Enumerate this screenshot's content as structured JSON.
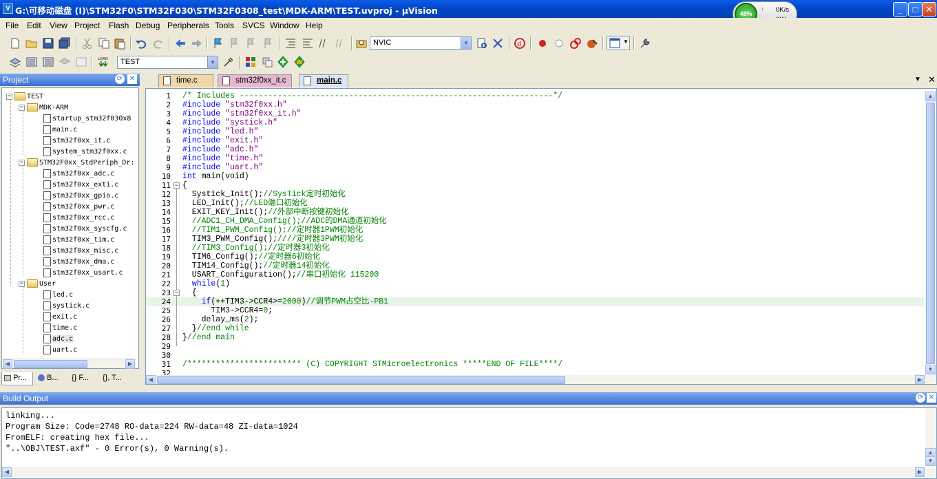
{
  "window": {
    "title": "G:\\可移动磁盘 (I)\\STM32F0\\STM32F030\\STM32F0308_test\\MDK-ARM\\TEST.uvproj - µVision",
    "app_icon": "V",
    "buttons": {
      "minimize": "_",
      "maximize": "□",
      "close": "✕"
    }
  },
  "net_widget": {
    "percent": "48%",
    "up_rate": "0K/s",
    "down_rate": "0K/s",
    "up_arrow": "↑",
    "down_arrow": "↓"
  },
  "menu": [
    "File",
    "Edit",
    "View",
    "Project",
    "Flash",
    "Debug",
    "Peripherals",
    "Tools",
    "SVCS",
    "Window",
    "Help"
  ],
  "toolbar": {
    "find_combo": "NVIC",
    "target_combo": "TEST"
  },
  "project_panel": {
    "title": "Project",
    "tree": [
      {
        "label": "TEST",
        "level": 0,
        "kind": "target",
        "expander": "−"
      },
      {
        "label": "MDK-ARM",
        "level": 1,
        "kind": "folder",
        "expander": "−"
      },
      {
        "label": "startup_stm32f030x8",
        "level": 2,
        "kind": "file"
      },
      {
        "label": "main.c",
        "level": 2,
        "kind": "file"
      },
      {
        "label": "stm32f0xx_it.c",
        "level": 2,
        "kind": "file"
      },
      {
        "label": "system_stm32f0xx.c",
        "level": 2,
        "kind": "file"
      },
      {
        "label": "STM32F0xx_StdPeriph_Dr:",
        "level": 1,
        "kind": "folder",
        "expander": "−"
      },
      {
        "label": "stm32f0xx_adc.c",
        "level": 2,
        "kind": "file"
      },
      {
        "label": "stm32f0xx_exti.c",
        "level": 2,
        "kind": "file"
      },
      {
        "label": "stm32f0xx_gpio.c",
        "level": 2,
        "kind": "file"
      },
      {
        "label": "stm32f0xx_pwr.c",
        "level": 2,
        "kind": "file"
      },
      {
        "label": "stm32f0xx_rcc.c",
        "level": 2,
        "kind": "file"
      },
      {
        "label": "stm32f0xx_syscfg.c",
        "level": 2,
        "kind": "file"
      },
      {
        "label": "stm32f0xx_tim.c",
        "level": 2,
        "kind": "file"
      },
      {
        "label": "stm32f0xx_misc.c",
        "level": 2,
        "kind": "file"
      },
      {
        "label": "stm32f0xx_dma.c",
        "level": 2,
        "kind": "file"
      },
      {
        "label": "stm32f0xx_usart.c",
        "level": 2,
        "kind": "file"
      },
      {
        "label": "User",
        "level": 1,
        "kind": "folder",
        "expander": "−"
      },
      {
        "label": "led.c",
        "level": 2,
        "kind": "file"
      },
      {
        "label": "systick.c",
        "level": 2,
        "kind": "file"
      },
      {
        "label": "exit.c",
        "level": 2,
        "kind": "file"
      },
      {
        "label": "time.c",
        "level": 2,
        "kind": "file"
      },
      {
        "label": "adc.c",
        "level": 2,
        "kind": "file",
        "selected": true
      },
      {
        "label": "uart.c",
        "level": 2,
        "kind": "file"
      }
    ],
    "tabs": [
      "Pr...",
      "B...",
      "{} F...",
      "{}, T..."
    ]
  },
  "editor_tabs": [
    {
      "label": "time.c",
      "active": false,
      "color": "#f0d8a8"
    },
    {
      "label": "stm32f0xx_it.c",
      "active": false,
      "color": "#e8b8d0"
    },
    {
      "label": "main.c",
      "active": true,
      "color": "#d8e6f8"
    }
  ],
  "editor": {
    "current_line": 24,
    "lines": [
      {
        "n": "1",
        "text": "/* Includes ------------------------------------------------------------------*/",
        "cls": "cm"
      },
      {
        "n": "2",
        "text": "#include \"stm32f0xx.h\"",
        "cls": "pp"
      },
      {
        "n": "3",
        "text": "#include \"stm32f0xx_it.h\"",
        "cls": "pp"
      },
      {
        "n": "4",
        "text": "#include \"systick.h\"",
        "cls": "pp"
      },
      {
        "n": "5",
        "text": "#include \"led.h\"",
        "cls": "pp"
      },
      {
        "n": "6",
        "text": "#include \"exit.h\"",
        "cls": "pp"
      },
      {
        "n": "7",
        "text": "#include \"adc.h\"",
        "cls": "pp"
      },
      {
        "n": "8",
        "text": "#include \"time.h\"",
        "cls": "pp"
      },
      {
        "n": "9",
        "text": "#include \"uart.h\"",
        "cls": "pp"
      },
      {
        "n": "10",
        "text": "int main(void)",
        "cls": "int"
      },
      {
        "n": "11",
        "text": "{",
        "cls": "plain"
      },
      {
        "n": "12",
        "text": "  Systick_Init();//SysTick定时初始化",
        "cls": "call"
      },
      {
        "n": "13",
        "text": "  LED_Init();//LED端口初始化",
        "cls": "call"
      },
      {
        "n": "14",
        "text": "  EXIT_KEY_Init();//外部中断按键初始化",
        "cls": "call"
      },
      {
        "n": "15",
        "text": "  //ADC1_CH_DMA_Config();//ADC的DMA通道初始化",
        "cls": "cm"
      },
      {
        "n": "16",
        "text": "  //TIM1_PWM_Config();//定时器1PWM初始化",
        "cls": "cm"
      },
      {
        "n": "17",
        "text": "  TIM3_PWM_Config();////定时器3PWM初始化",
        "cls": "call"
      },
      {
        "n": "18",
        "text": "  //TIM3_Config();//定时器3初始化",
        "cls": "cm"
      },
      {
        "n": "19",
        "text": "  TIM6_Config();//定时器6初始化",
        "cls": "call"
      },
      {
        "n": "20",
        "text": "  TIM14_Config();//定时器14初始化",
        "cls": "call"
      },
      {
        "n": "21",
        "text": "  USART_Configuration();//串口初始化 115200",
        "cls": "call"
      },
      {
        "n": "22",
        "text": "  while(1)",
        "cls": "while"
      },
      {
        "n": "23",
        "text": "  {",
        "cls": "plain"
      },
      {
        "n": "24",
        "text": "    if(++TIM3->CCR4>=2000)//调节PWM占空比-PB1",
        "cls": "if"
      },
      {
        "n": "25",
        "text": "      TIM3->CCR4=0;",
        "cls": "assign"
      },
      {
        "n": "26",
        "text": "    delay_ms(2);",
        "cls": "delay"
      },
      {
        "n": "27",
        "text": "  }//end while",
        "cls": "endc"
      },
      {
        "n": "28",
        "text": "}//end main",
        "cls": "endc0"
      },
      {
        "n": "29",
        "text": "",
        "cls": "plain"
      },
      {
        "n": "30",
        "text": "",
        "cls": "plain"
      },
      {
        "n": "31",
        "text": "/************************ (C) COPYRIGHT STMicroelectronics *****END OF FILE****/",
        "cls": "cm"
      },
      {
        "n": "32",
        "text": "",
        "cls": "plain"
      }
    ]
  },
  "build_output": {
    "title": "Build Output",
    "lines": [
      "linking...",
      "Program Size: Code=2748 RO-data=224 RW-data=48 ZI-data=1024",
      "FromELF: creating hex file...",
      "\"..\\OBJ\\TEST.axf\" - 0 Error(s), 0 Warning(s)."
    ]
  },
  "colors": {
    "titlebar": "#0548c9",
    "panel_header": "#3d6fd2",
    "current_line": "#e8f4e6",
    "keyword": "#0000ff",
    "comment": "#008000",
    "string": "#800080"
  }
}
